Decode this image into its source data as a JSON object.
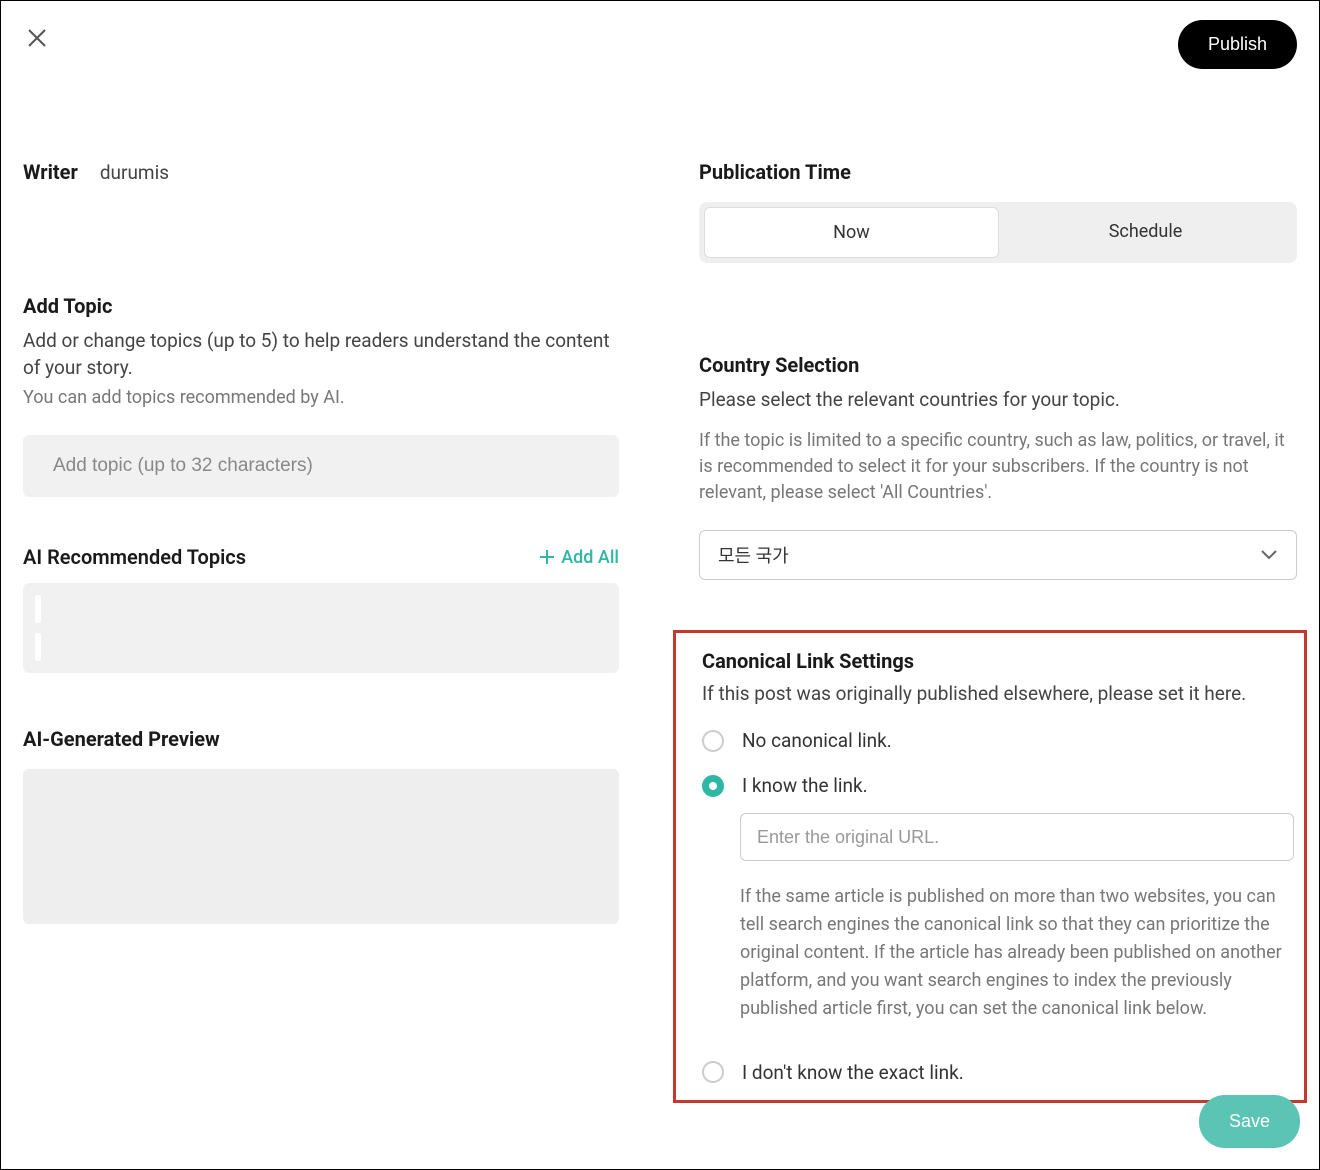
{
  "header": {
    "publish_label": "Publish"
  },
  "writer": {
    "label": "Writer",
    "name": "durumis"
  },
  "add_topic": {
    "title": "Add Topic",
    "desc": "Add or change topics (up to 5) to help readers understand the content of your story.",
    "hint": "You can add topics recommended by AI.",
    "placeholder": "Add topic (up to 32 characters)"
  },
  "ai_topics": {
    "title": "AI Recommended Topics",
    "add_all_label": "Add All"
  },
  "preview": {
    "title": "AI-Generated Preview"
  },
  "publication_time": {
    "title": "Publication Time",
    "now_label": "Now",
    "schedule_label": "Schedule"
  },
  "country_selection": {
    "title": "Country Selection",
    "desc": "Please select the relevant countries for your topic.",
    "hint": "If the topic is limited to a specific country, such as law, politics, or travel, it is recommended to select it for your subscribers. If the country is not relevant, please select 'All Countries'.",
    "selected_value": "모든 국가"
  },
  "canonical": {
    "title": "Canonical Link Settings",
    "desc": "If this post was originally published elsewhere, please set it here.",
    "option_none": "No canonical link.",
    "option_know": "I know the link.",
    "option_unknown": "I don't know the exact link.",
    "url_placeholder": "Enter the original URL.",
    "help": "If the same article is published on more than two websites, you can tell search engines the canonical link so that they can prioritize the original content. If the article has already been published on another platform, and you want search engines to index the previously published article first, you can set the canonical link below.",
    "selected": "know"
  },
  "save_label": "Save",
  "colors": {
    "accent_teal": "#2fb7a3",
    "highlight_border": "#c13a2c"
  }
}
